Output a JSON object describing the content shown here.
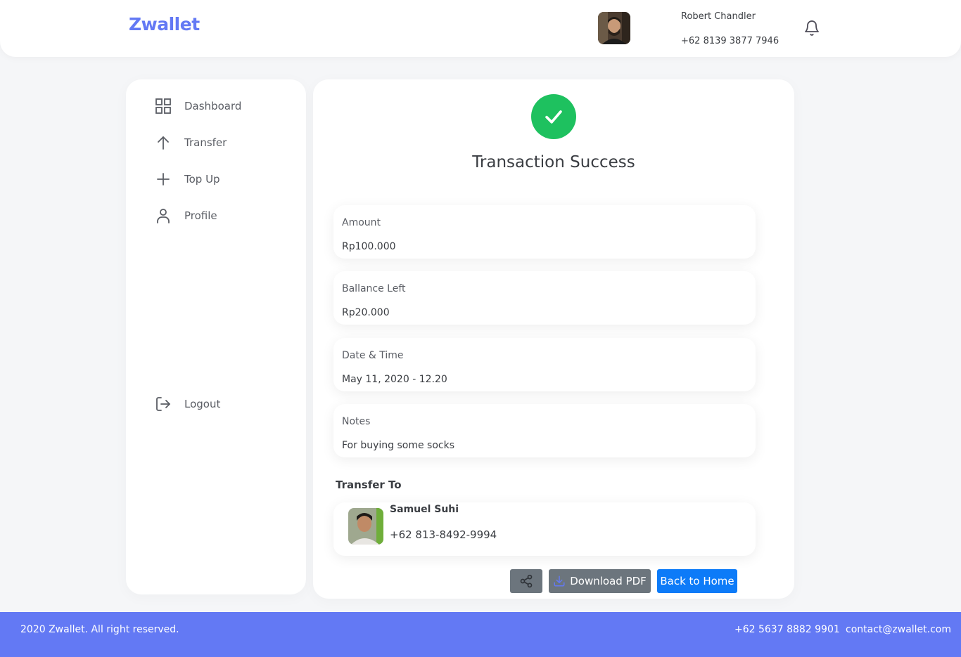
{
  "header": {
    "brand": "Zwallet",
    "user_name": "Robert Chandler",
    "user_phone": "+62 8139 3877 7946"
  },
  "sidebar": {
    "items": [
      {
        "label": "Dashboard",
        "icon": "grid-icon"
      },
      {
        "label": "Transfer",
        "icon": "arrow-up-icon"
      },
      {
        "label": "Top Up",
        "icon": "plus-icon"
      },
      {
        "label": "Profile",
        "icon": "user-icon"
      }
    ],
    "logout_label": "Logout"
  },
  "main": {
    "title": "Transaction Success",
    "details": [
      {
        "label": "Amount",
        "value": "Rp100.000"
      },
      {
        "label": "Ballance Left",
        "value": "Rp20.000"
      },
      {
        "label": "Date & Time",
        "value": "May 11, 2020 - 12.20"
      },
      {
        "label": "Notes",
        "value": "For buying some socks"
      }
    ],
    "transfer_to_label": "Transfer To",
    "recipient": {
      "name": "Samuel Suhi",
      "phone": "+62 813-8492-9994"
    },
    "buttons": {
      "download": "Download PDF",
      "home": "Back to Home"
    }
  },
  "footer": {
    "copyright": "2020 Zwallet. All right reserved.",
    "phone": "+62 5637 8882 9901",
    "email": "contact@zwallet.com"
  },
  "colors": {
    "brand": "#6379f4",
    "success": "#1ec15f",
    "primary_button": "#0d7bf8",
    "secondary_button": "#6c757d"
  }
}
